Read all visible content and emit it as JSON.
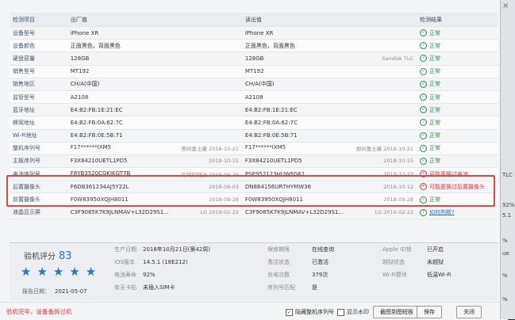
{
  "header": {
    "item": "检测项目",
    "factory": "出厂值",
    "read": "读出值",
    "result": "检测结果"
  },
  "rows": [
    {
      "item": "设备型号",
      "factory": "iPhone XR",
      "factory_sub": "",
      "read": "iPhone XR",
      "read_sub": "",
      "result": "正常",
      "status": "ok"
    },
    {
      "item": "设备颜色",
      "factory": "正面黑色，背面黑色",
      "factory_sub": "",
      "read": "正面黑色，背面黑色",
      "read_sub": "",
      "result": "正常",
      "status": "ok"
    },
    {
      "item": "硬盘容量",
      "factory": "128GB",
      "factory_sub": "",
      "read": "128GB",
      "read_sub": "Sandisk TLC",
      "result": "正常",
      "status": "ok"
    },
    {
      "item": "销售型号",
      "factory": "MT192",
      "factory_sub": "",
      "read": "MT192",
      "read_sub": "",
      "result": "正常",
      "status": "ok"
    },
    {
      "item": "销售地区",
      "factory": "CH/A(中国)",
      "factory_sub": "",
      "read": "CH/A(中国)",
      "read_sub": "",
      "result": "正常",
      "status": "ok"
    },
    {
      "item": "监管型号",
      "factory": "A2108",
      "factory_sub": "",
      "read": "A2108",
      "read_sub": "",
      "result": "正常",
      "status": "ok"
    },
    {
      "item": "蓝牙地址",
      "factory": "E4:B2:FB:1E:21:EC",
      "factory_sub": "",
      "read": "E4:B2:FB:1E:21:EC",
      "read_sub": "",
      "result": "正常",
      "status": "ok"
    },
    {
      "item": "蜂窝地址",
      "factory": "E4:B2:FB:0A:62:7C",
      "factory_sub": "",
      "read": "E4:B2:FB:0A:62:7C",
      "read_sub": "",
      "result": "正常",
      "status": "ok"
    },
    {
      "item": "Wi-Fi地址",
      "factory": "E4:B2:FB:0E:5B:71",
      "factory_sub": "",
      "read": "E4:B2:FB:0E:5B:71",
      "read_sub": "",
      "result": "正常",
      "status": "ok"
    },
    {
      "item": "整机序列号",
      "factory": "F17******IXM5",
      "factory_sub": "郑州富士康  2018-10-21",
      "read": "F17******IXM5",
      "read_sub": "郑州富士康  2018-10-21",
      "result": "正常",
      "status": "ok"
    },
    {
      "item": "主板序列号",
      "factory": "F3X84210UETL1PD5",
      "factory_sub": "2018-10-15",
      "read": "F3X84210UETL1PD5",
      "read_sub": "2018-10-15",
      "result": "正常",
      "status": "ok"
    },
    {
      "item": "电池序列号",
      "factory": "F8YB3520CGKJKGT7B",
      "factory_sub": "深圳欣旺达  2018-08-28",
      "read": "PSE952123HUWFG61",
      "read_sub": "2019-12-23",
      "result": "可能更换过电池",
      "status": "bad"
    },
    {
      "item": "后置摄像头",
      "factory": "F6DB361234AJ5Y22L",
      "factory_sub": "2018-09-03",
      "read": "DN884156UR7HYMW36",
      "read_sub": "2018-10-12",
      "result": "可能更换过后置摄像头",
      "status": "bad"
    },
    {
      "item": "前置摄像头",
      "factory": "F0W83950XQJH8011",
      "factory_sub": "2018-09-28",
      "read": "F0W83950XQJH8011",
      "read_sub": "2018-09-28",
      "result": "正常",
      "status": "ok"
    },
    {
      "item": "液晶显示屏",
      "factory": "C3F9085K7K9JLNMAV+L32D29S1...",
      "factory_sub": "LG  2019-02-22",
      "read": "C3F9085K7K9JLNMAV+L32D29S1...",
      "read_sub": "LG  2019-02-22",
      "result": "如何判断?",
      "status": "help"
    }
  ],
  "panel": {
    "score_label": "验机评分",
    "score": "83",
    "star_count": 5,
    "report_label": "报告日期：",
    "report_date": "2021-05-07",
    "col1": [
      {
        "k": "生产日期",
        "v": "2018年10月21日(第42周)"
      },
      {
        "k": "iOS版本",
        "v": "14.5.1 (18E212)"
      },
      {
        "k": "电池寿命",
        "v": "92%"
      },
      {
        "k": "有无卡贴",
        "v": "未插入SIM卡"
      }
    ],
    "col2": [
      {
        "k": "保修期限",
        "v": "在线查询"
      },
      {
        "k": "激活状态",
        "v": "已激活"
      },
      {
        "k": "充电次数",
        "v": "379次"
      },
      {
        "k": "序列号匹配",
        "v": "是"
      }
    ],
    "col3": [
      {
        "k": "Apple ID锁",
        "v": "已开启"
      },
      {
        "k": "越狱状态",
        "v": "未越狱"
      },
      {
        "k": "Wi-Fi模块",
        "v": "低温Wi-Fi"
      },
      {
        "k": "",
        "v": ""
      }
    ]
  },
  "bottom": {
    "warning": "验机完毕，设备备拆过机",
    "hide_serial": "隐藏整机序列号",
    "show_watermark": "显示水印",
    "screenshot": "截图到图短板",
    "save": "保存",
    "close": "关闭"
  },
  "right_strip": {
    "items": [
      "TLC",
      "92%",
      "5.1",
      "%",
      "ue",
      "%",
      "%"
    ]
  }
}
